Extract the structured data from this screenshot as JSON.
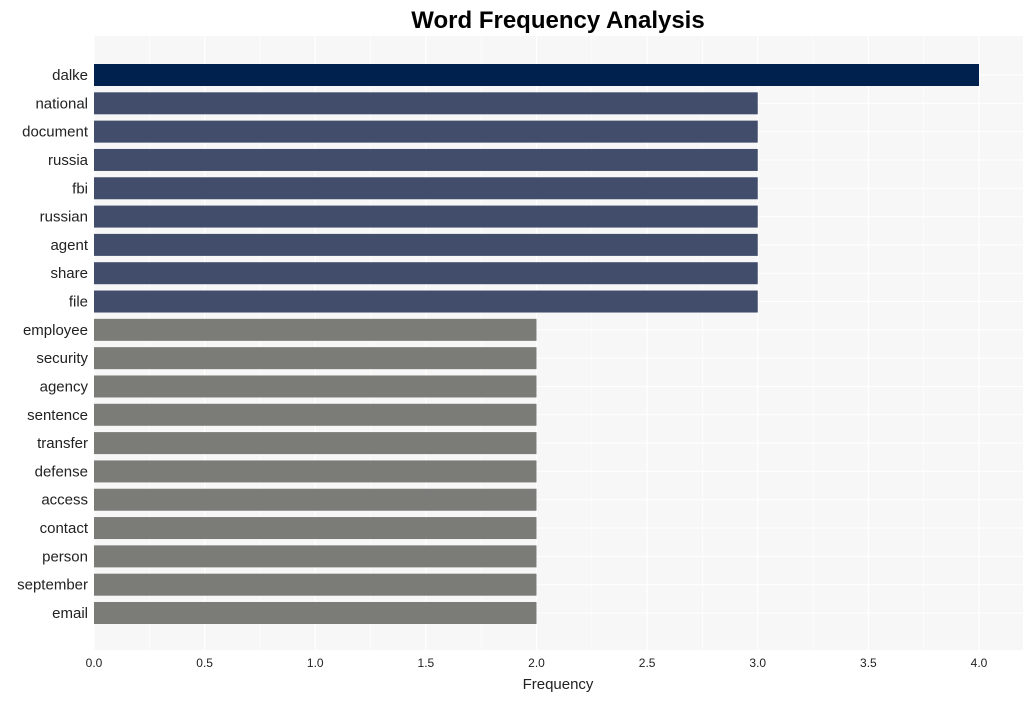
{
  "chart_data": {
    "type": "bar",
    "orientation": "horizontal",
    "title": "Word Frequency Analysis",
    "xlabel": "Frequency",
    "ylabel": "",
    "xlim": [
      0,
      4.2
    ],
    "xticks": [
      "0.0",
      "0.5",
      "1.0",
      "1.5",
      "2.0",
      "2.5",
      "3.0",
      "3.5",
      "4.0"
    ],
    "grid": true,
    "categories": [
      "dalke",
      "national",
      "document",
      "russia",
      "fbi",
      "russian",
      "agent",
      "share",
      "file",
      "employee",
      "security",
      "agency",
      "sentence",
      "transfer",
      "defense",
      "access",
      "contact",
      "person",
      "september",
      "email"
    ],
    "values": [
      4,
      3,
      3,
      3,
      3,
      3,
      3,
      3,
      3,
      2,
      2,
      2,
      2,
      2,
      2,
      2,
      2,
      2,
      2,
      2
    ],
    "colors": {
      "top": "#00204e",
      "mid": "#414d6b",
      "low": "#7b7b78",
      "background": "#f7f7f7",
      "grid": "#ffffff"
    }
  }
}
